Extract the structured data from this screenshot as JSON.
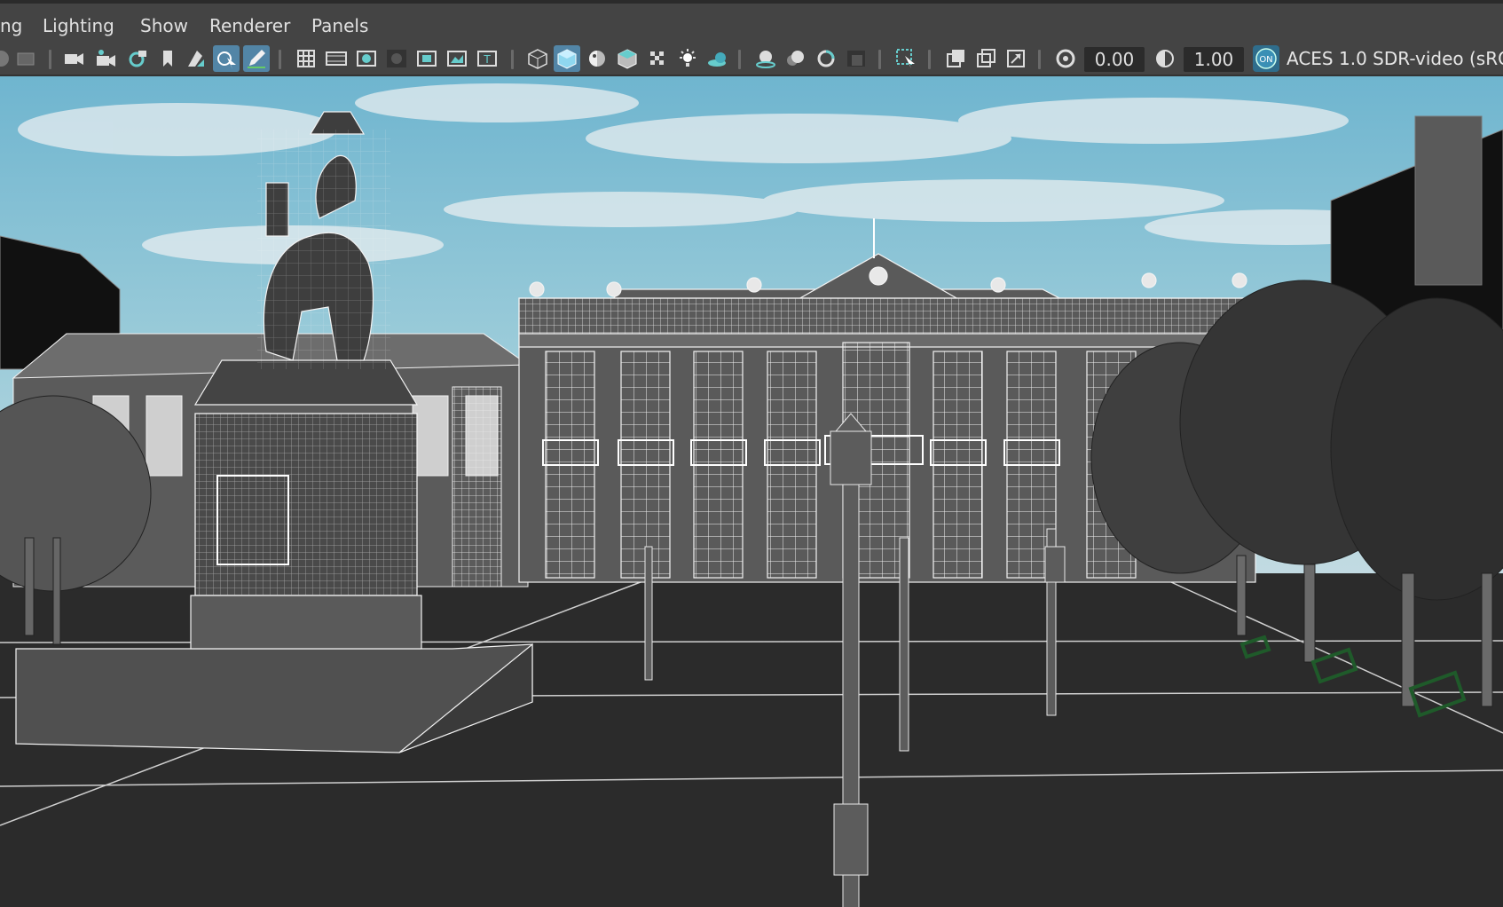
{
  "menu": {
    "items": [
      "ng",
      "Lighting",
      "Show",
      "Renderer",
      "Panels"
    ]
  },
  "toolbar": {
    "exposure_value": "0.00",
    "gamma_value": "1.00",
    "view_transform_toggle": "ON",
    "color_space": "ACES 1.0 SDR-video (sRG",
    "icons": [
      "camera-icon",
      "camera-attributes-icon",
      "camera-settings-icon",
      "bookmark-icon",
      "image-plane-icon",
      "select-camera-icon",
      "grease-pencil-icon",
      "grid-icon",
      "film-gate-icon",
      "resolution-gate-icon",
      "gate-mask-icon",
      "field-chart-icon",
      "safe-action-icon",
      "safe-title-icon",
      "wireframe-icon",
      "smooth-shade-icon",
      "wireframe-on-shaded-icon",
      "textured-icon",
      "checker-icon",
      "lights-icon",
      "shadows-icon",
      "screen-space-ao-icon",
      "motion-blur-icon",
      "multisample-aa-icon",
      "depth-of-field-icon",
      "isolate-select-icon",
      "xray-icon",
      "xray-joints-icon",
      "xray-components-icon",
      "exposure-icon",
      "gamma-icon",
      "color-management-icon"
    ],
    "active_icons": [
      "select-camera-icon",
      "grease-pencil-icon",
      "smooth-shade-icon"
    ]
  },
  "viewport": {
    "sky_color": "#8fc6d8",
    "ground_color": "#2b2b2b",
    "wireframe_color": "#f2f2f2",
    "bench_color": "#1f5a2a"
  }
}
